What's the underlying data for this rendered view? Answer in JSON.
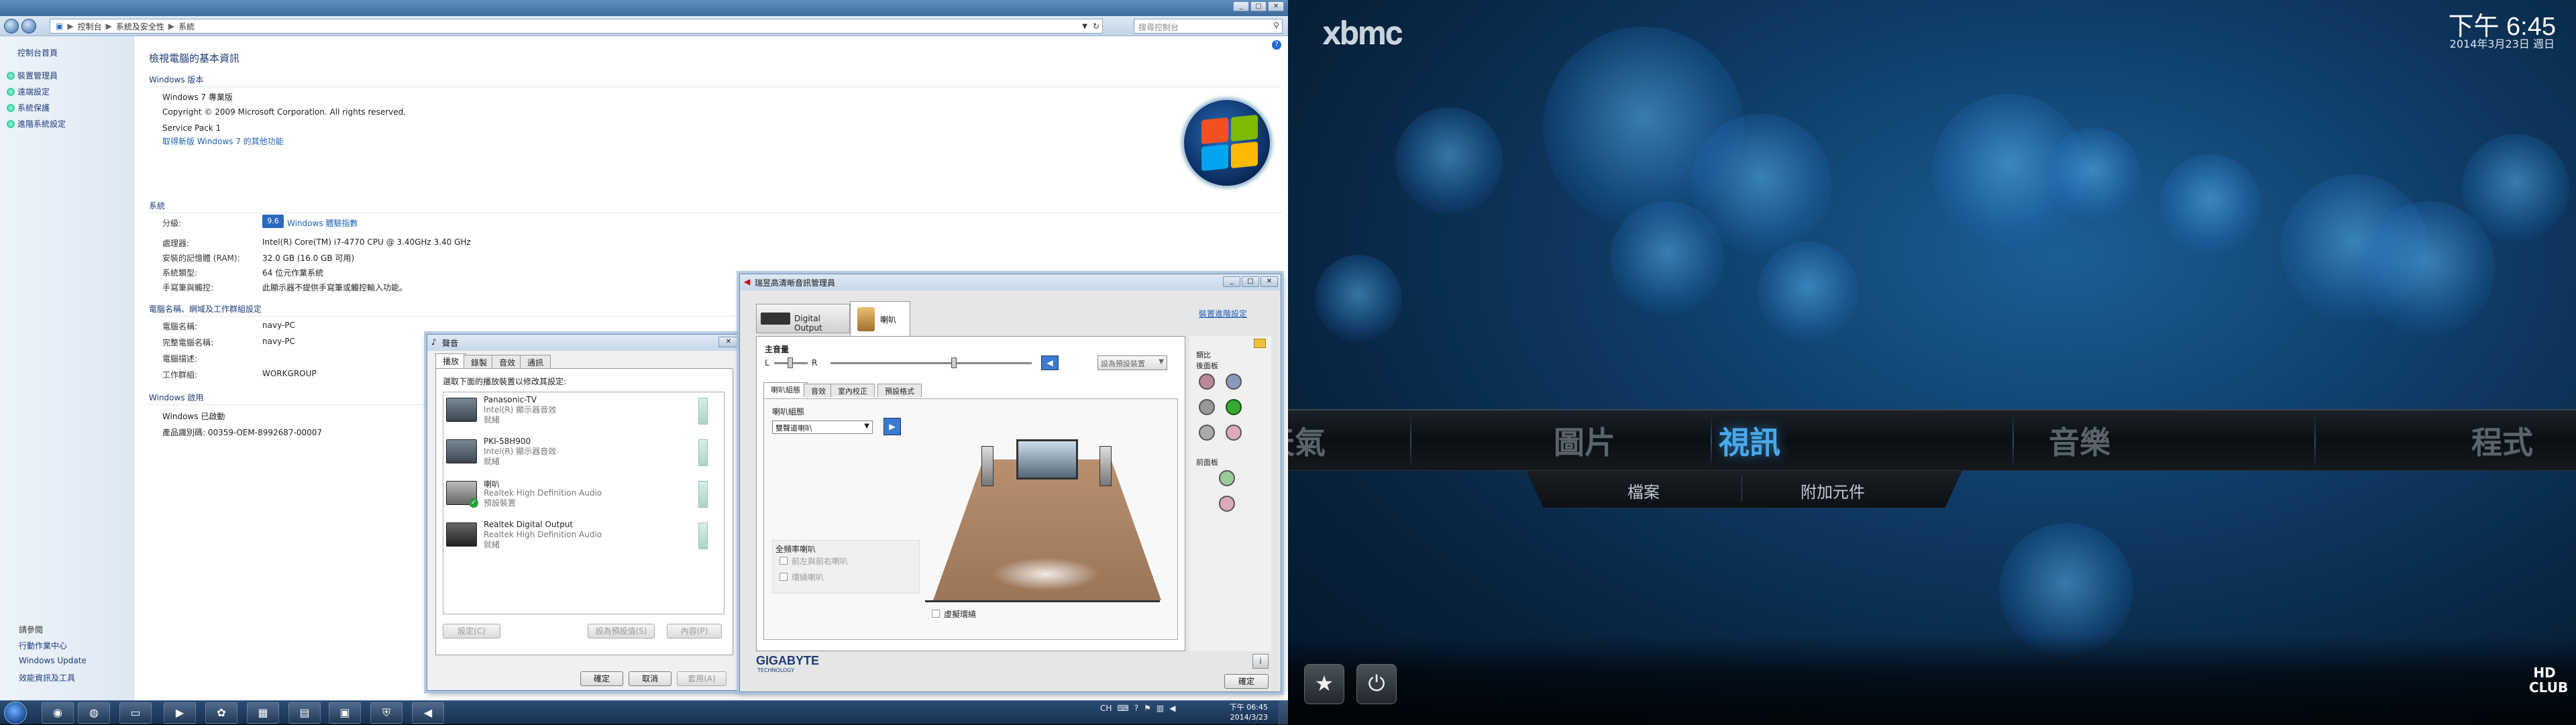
{
  "explorer": {
    "address": [
      "控制台",
      "系統及安全性",
      "系統"
    ],
    "search_placeholder": "搜尋控制台",
    "sidebar": {
      "home": "控制台首頁",
      "links": [
        "裝置管理員",
        "遠端設定",
        "系統保護",
        "進階系統設定"
      ],
      "see_also": "請參閱",
      "see_also_links": [
        "行動作業中心",
        "Windows Update",
        "效能資訊及工具"
      ]
    },
    "main": {
      "title": "檢視電腦的基本資訊",
      "edition_head": "Windows 版本",
      "edition": "Windows 7 專業版",
      "copyright": "Copyright © 2009 Microsoft Corporation.  All rights reserved.",
      "service_pack": "Service Pack 1",
      "upgrade_link": "取得新版 Windows 7 的其他功能",
      "system_head": "系統",
      "rating_label": "分級:",
      "rating_badge": "9.6",
      "rating_link": "Windows 體驗指數",
      "rows": [
        {
          "label": "處理器:",
          "value": "Intel(R) Core(TM) i7-4770 CPU @ 3.40GHz   3.40 GHz"
        },
        {
          "label": "安裝的記憶體 (RAM):",
          "value": "32.0 GB (16.0 GB 可用)"
        },
        {
          "label": "系統類型:",
          "value": "64 位元作業系統"
        },
        {
          "label": "手寫筆與觸控:",
          "value": "此顯示器不提供手寫筆或觸控輸入功能。"
        }
      ],
      "computer_head": "電腦名稱、網域及工作群組設定",
      "computer_rows": [
        {
          "label": "電腦名稱:",
          "value": "navy-PC"
        },
        {
          "label": "完整電腦名稱:",
          "value": "navy-PC"
        },
        {
          "label": "電腦描述:",
          "value": ""
        },
        {
          "label": "工作群組:",
          "value": "WORKGROUP"
        }
      ],
      "activation_head": "Windows 啟用",
      "activated": "Windows 已啟動",
      "product_id": "產品識別碼: 00359-OEM-8992687-00007"
    }
  },
  "sound_dialog": {
    "title": "聲音",
    "tabs": [
      "播放",
      "錄製",
      "音效",
      "通訊"
    ],
    "instruction": "選取下面的播放裝置以修改其設定:",
    "devices": [
      {
        "name": "Panasonic-TV",
        "sub1": "Intel(R) 顯示器音效",
        "sub2": "就緒"
      },
      {
        "name": "PKI-58H900",
        "sub1": "Intel(R) 顯示器音效",
        "sub2": "就緒"
      },
      {
        "name": "喇叭",
        "sub1": "Realtek High Definition Audio",
        "sub2": "預設裝置"
      },
      {
        "name": "Realtek Digital Output",
        "sub1": "Realtek High Definition Audio",
        "sub2": "就緒"
      }
    ],
    "configure": "設定(C)",
    "set_default": "設為預設值(S)",
    "properties": "內容(P)",
    "ok": "確定",
    "cancel": "取消",
    "apply": "套用(A)"
  },
  "realtek": {
    "title": "瑞昱高清晰音訊管理員",
    "tab_digital": "Digital Output",
    "tab_speaker": "喇叭",
    "device_advanced": "裝置進階設定",
    "main_volume": "主音量",
    "left": "L",
    "right": "R",
    "set_default": "設為預設裝置",
    "subtabs": [
      "喇叭組態",
      "音效",
      "室內校正",
      "預設格式"
    ],
    "config_label": "喇叭組態",
    "config_value": "雙聲道喇叭",
    "fullrange_head": "全頻率喇叭",
    "fullrange_opts": [
      "前左與前右喇叭",
      "環繞喇叭"
    ],
    "virtual_surround": "虛擬環繞",
    "jacks_head": "類比",
    "back_panel": "後面板",
    "front_panel": "前面板",
    "brand": "GIGABYTE",
    "brand_sub": "TECHNOLOGY",
    "ok": "確定"
  },
  "taskbar": {
    "lang": "CH",
    "time": "下午 06:45",
    "date": "2014/3/23"
  },
  "xbmc": {
    "logo": "xbmc",
    "time": "下午 6:45",
    "date": "2014年3月23日 週日",
    "menu": [
      "天氣",
      "圖片",
      "視訊",
      "音樂",
      "程式"
    ],
    "submenu": [
      "檔案",
      "附加元件"
    ],
    "badge": "HD CLUB"
  },
  "colors": {
    "xbmc_highlight": "#4aa8e8",
    "explorer_link": "#1e5fb4"
  }
}
